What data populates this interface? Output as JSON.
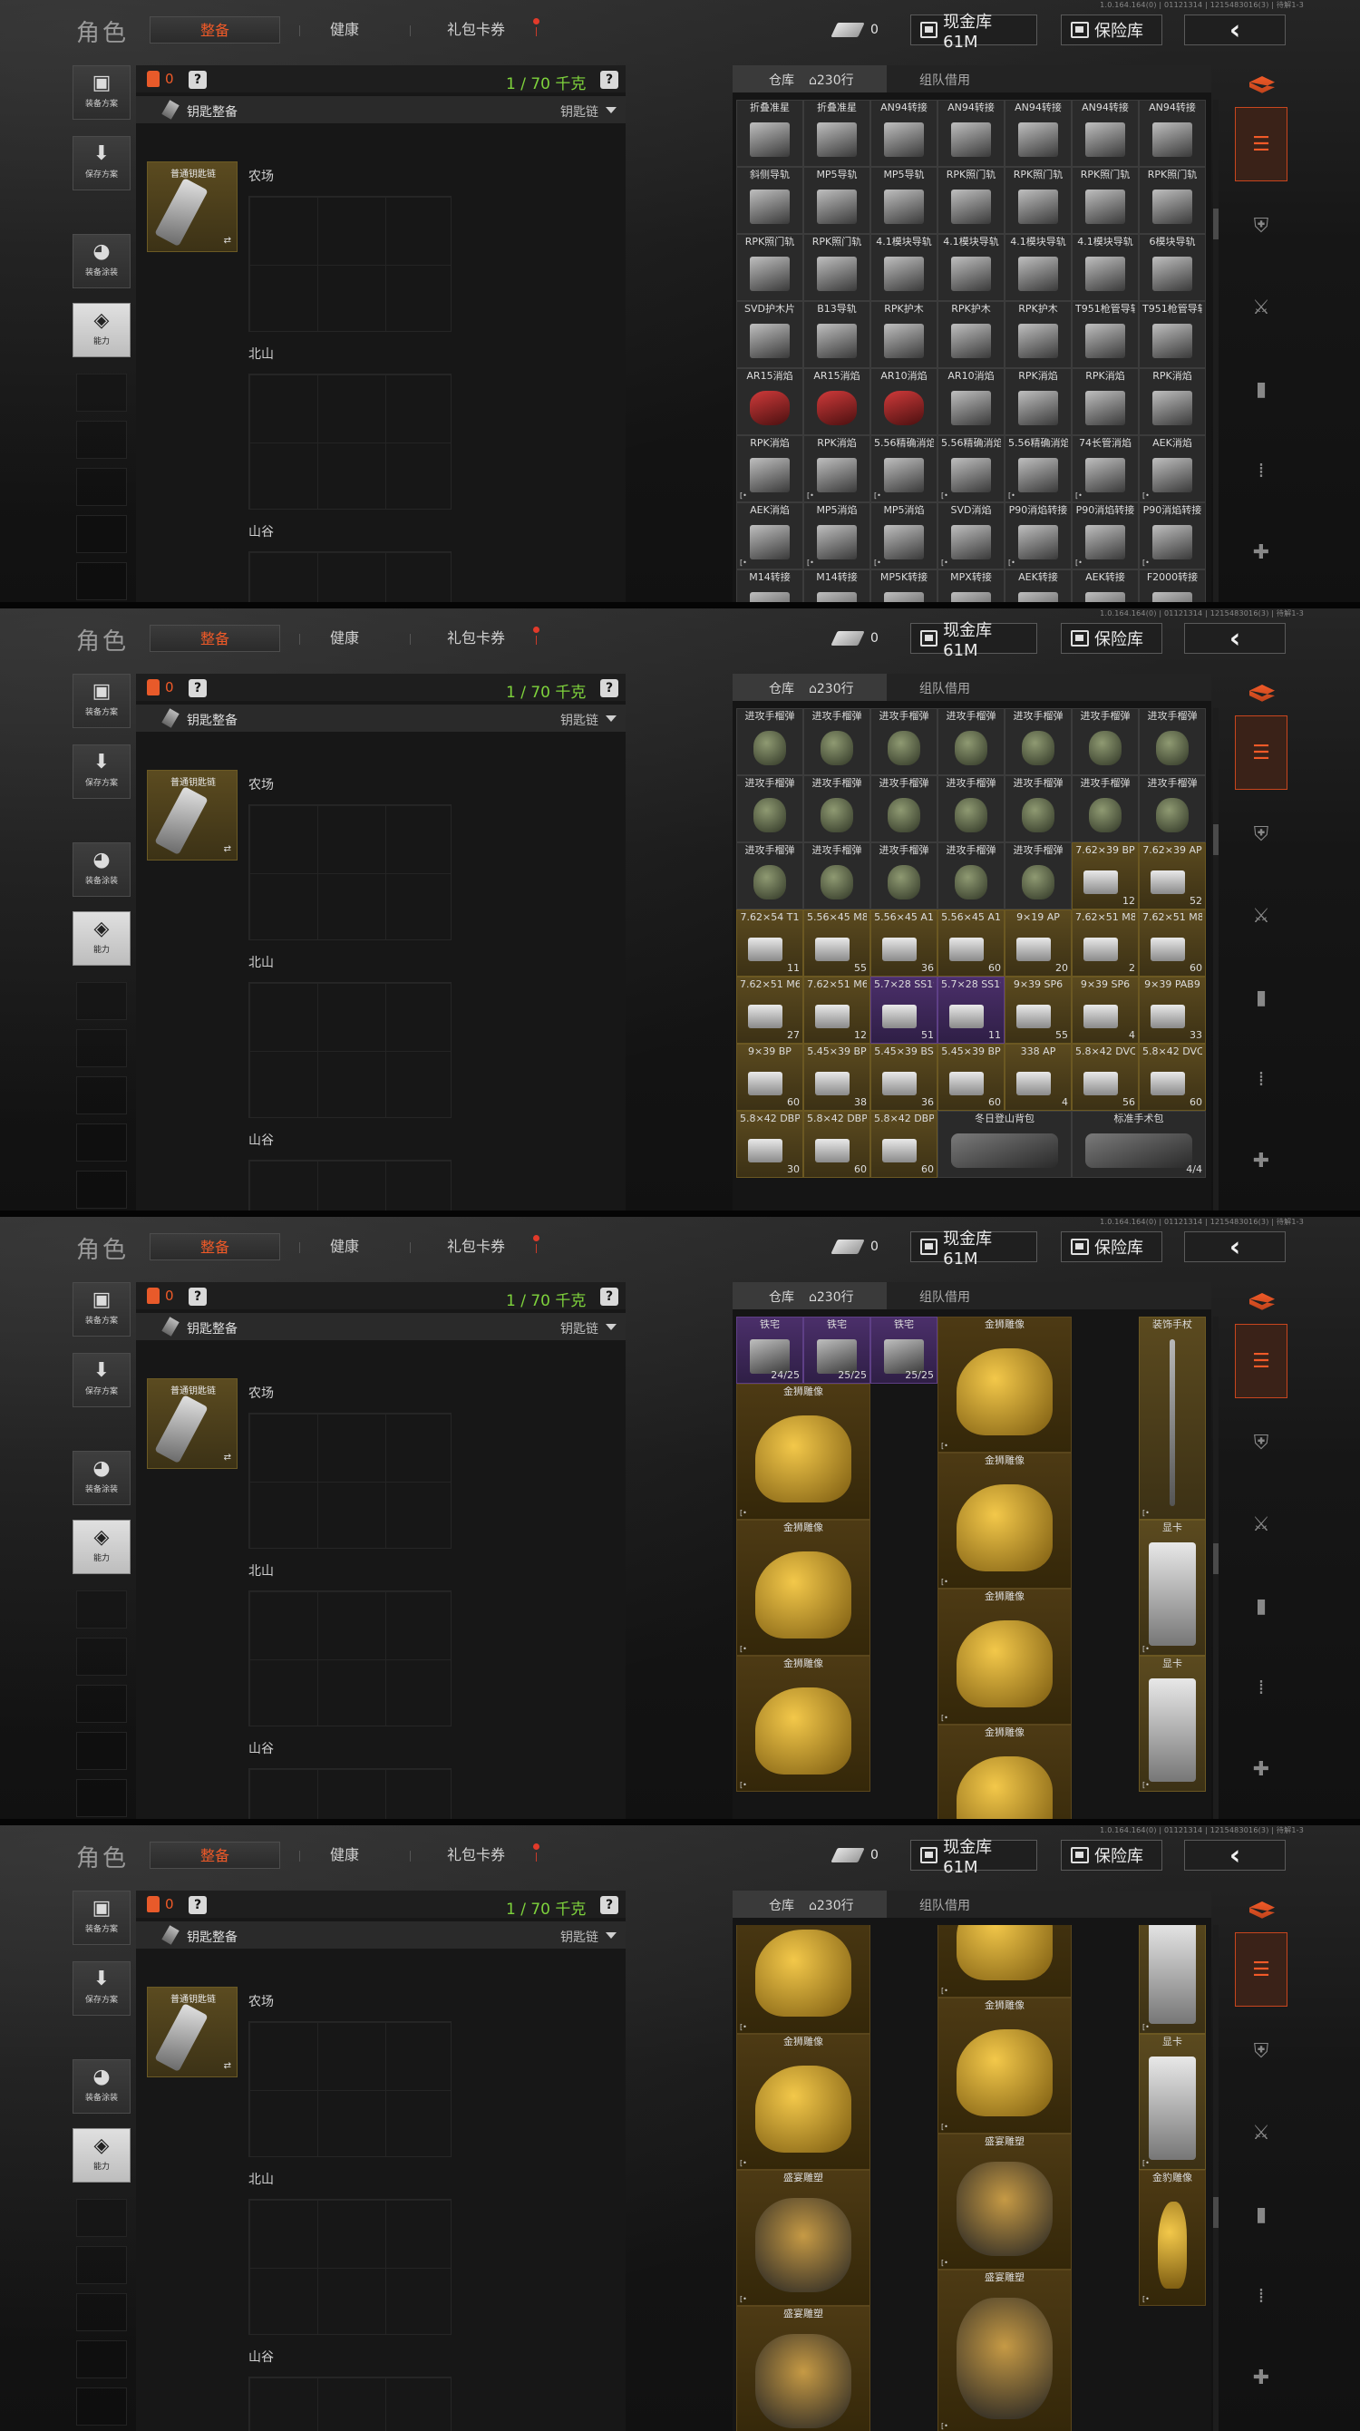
{
  "version": "1.0.164.164(0) | 01121314 | 1215483016(3) | 待解1-3",
  "header": {
    "title": "角色",
    "tabs": [
      "整备",
      "健康",
      "礼包卡券"
    ],
    "key_count": "0",
    "cash_label": "现金库 61M",
    "safe_label": "保险库",
    "back_icon": "‹"
  },
  "left_sidebar": {
    "buttons": [
      "装备方案",
      "保存方案",
      "装备涂装",
      "能力"
    ]
  },
  "equip": {
    "bag_count": "0",
    "weight": "1 / 70 千克",
    "help": "?",
    "key_label": "钥匙整备",
    "chain_label": "钥匙链",
    "key_item_name": "普通钥匙链",
    "regions": [
      "农场",
      "北山",
      "山谷"
    ]
  },
  "warehouse": {
    "tab_label": "仓库",
    "rows_label": "230行",
    "team_label": "组队借用"
  },
  "colors": {
    "accent": "#f05a28",
    "weight_green": "#7ed23c",
    "gold_bg": "#5b4a1f",
    "purple_bg": "#4b2f6a"
  },
  "frames": [
    {
      "items": [
        {
          "n": "折叠准星",
          "c": ""
        },
        {
          "n": "折叠准星",
          "c": ""
        },
        {
          "n": "AN94转接",
          "c": ""
        },
        {
          "n": "AN94转接",
          "c": ""
        },
        {
          "n": "AN94转接",
          "c": ""
        },
        {
          "n": "AN94转接",
          "c": ""
        },
        {
          "n": "AN94转接",
          "c": ""
        },
        {
          "n": "斜侧导轨",
          "c": ""
        },
        {
          "n": "MP5导轨",
          "c": ""
        },
        {
          "n": "MP5导轨",
          "c": ""
        },
        {
          "n": "RPK照门轨",
          "c": ""
        },
        {
          "n": "RPK照门轨",
          "c": ""
        },
        {
          "n": "RPK照门轨",
          "c": ""
        },
        {
          "n": "RPK照门轨",
          "c": ""
        },
        {
          "n": "RPK照门轨",
          "c": ""
        },
        {
          "n": "RPK照门轨",
          "c": ""
        },
        {
          "n": "4.1模块导轨",
          "c": ""
        },
        {
          "n": "4.1模块导轨",
          "c": ""
        },
        {
          "n": "4.1模块导轨",
          "c": ""
        },
        {
          "n": "4.1模块导轨",
          "c": ""
        },
        {
          "n": "6模块导轨",
          "c": ""
        },
        {
          "n": "SVD护木片",
          "c": ""
        },
        {
          "n": "B13导轨",
          "c": ""
        },
        {
          "n": "RPK护木",
          "c": ""
        },
        {
          "n": "RPK护木",
          "c": ""
        },
        {
          "n": "RPK护木",
          "c": ""
        },
        {
          "n": "T951枪管导轨",
          "c": ""
        },
        {
          "n": "T951枪管导轨",
          "c": ""
        },
        {
          "n": "AR15消焰",
          "c": ""
        },
        {
          "n": "AR15消焰",
          "c": ""
        },
        {
          "n": "AR10消焰",
          "c": ""
        },
        {
          "n": "AR10消焰",
          "c": ""
        },
        {
          "n": "RPK消焰",
          "c": ""
        },
        {
          "n": "RPK消焰",
          "c": ""
        },
        {
          "n": "RPK消焰",
          "c": ""
        },
        {
          "n": "RPK消焰",
          "c": ""
        },
        {
          "n": "RPK消焰",
          "c": ""
        },
        {
          "n": "5.56精确消焰",
          "c": ""
        },
        {
          "n": "5.56精确消焰",
          "c": ""
        },
        {
          "n": "5.56精确消焰",
          "c": ""
        },
        {
          "n": "74长管消焰",
          "c": ""
        },
        {
          "n": "AEK消焰",
          "c": ""
        },
        {
          "n": "AEK消焰",
          "c": ""
        },
        {
          "n": "MP5消焰",
          "c": ""
        },
        {
          "n": "MP5消焰",
          "c": ""
        },
        {
          "n": "SVD消焰",
          "c": ""
        },
        {
          "n": "P90消焰转接",
          "c": ""
        },
        {
          "n": "P90消焰转接",
          "c": ""
        },
        {
          "n": "P90消焰转接",
          "c": ""
        },
        {
          "n": "M14转接",
          "c": ""
        },
        {
          "n": "M14转接",
          "c": ""
        },
        {
          "n": "MP5K转接",
          "c": ""
        },
        {
          "n": "MPX转接",
          "c": ""
        },
        {
          "n": "AEK转接",
          "c": ""
        },
        {
          "n": "AEK转接",
          "c": ""
        },
        {
          "n": "F2000转接",
          "c": ""
        }
      ]
    },
    {
      "items": [
        {
          "n": "进攻手榴弹",
          "c": ""
        },
        {
          "n": "进攻手榴弹",
          "c": ""
        },
        {
          "n": "进攻手榴弹",
          "c": ""
        },
        {
          "n": "进攻手榴弹",
          "c": ""
        },
        {
          "n": "进攻手榴弹",
          "c": ""
        },
        {
          "n": "进攻手榴弹",
          "c": ""
        },
        {
          "n": "进攻手榴弹",
          "c": ""
        },
        {
          "n": "进攻手榴弹",
          "c": ""
        },
        {
          "n": "进攻手榴弹",
          "c": ""
        },
        {
          "n": "进攻手榴弹",
          "c": ""
        },
        {
          "n": "进攻手榴弹",
          "c": ""
        },
        {
          "n": "进攻手榴弹",
          "c": ""
        },
        {
          "n": "进攻手榴弹",
          "c": ""
        },
        {
          "n": "进攻手榴弹",
          "c": ""
        },
        {
          "n": "进攻手榴弹",
          "c": ""
        },
        {
          "n": "进攻手榴弹",
          "c": ""
        },
        {
          "n": "进攻手榴弹",
          "c": ""
        },
        {
          "n": "进攻手榴弹",
          "c": ""
        },
        {
          "n": "进攻手榴弹",
          "c": ""
        },
        {
          "n": "7.62×39 BP",
          "c": "12"
        },
        {
          "n": "7.62×39 AP",
          "c": "52"
        },
        {
          "n": "7.62×54 T1",
          "c": "11"
        },
        {
          "n": "5.56×45 M855",
          "c": "55"
        },
        {
          "n": "5.56×45 A1",
          "c": "36"
        },
        {
          "n": "5.56×45 A1",
          "c": "60"
        },
        {
          "n": "9×19 AP",
          "c": "20"
        },
        {
          "n": "7.62×51 M80",
          "c": "2"
        },
        {
          "n": "7.62×51 M80",
          "c": "60"
        },
        {
          "n": "7.62×51 M62",
          "c": "27"
        },
        {
          "n": "7.62×51 M61",
          "c": "12"
        },
        {
          "n": "5.7×28 SS190",
          "c": "51"
        },
        {
          "n": "5.7×28 SS190",
          "c": "11"
        },
        {
          "n": "9×39 SP6",
          "c": "55"
        },
        {
          "n": "9×39 SP6",
          "c": "4"
        },
        {
          "n": "9×39 PAB9",
          "c": "33"
        },
        {
          "n": "9×39 BP",
          "c": "60"
        },
        {
          "n": "5.45×39 BP",
          "c": "38"
        },
        {
          "n": "5.45×39 BS",
          "c": "36"
        },
        {
          "n": "5.45×39 BP",
          "c": "60"
        },
        {
          "n": "338 AP",
          "c": "4"
        },
        {
          "n": "5.8×42 DVC12",
          "c": "56"
        },
        {
          "n": "5.8×42 DVC12",
          "c": "60"
        },
        {
          "n": "5.8×42 DBP88",
          "c": "30"
        },
        {
          "n": "5.8×42 DBP88",
          "c": "60"
        },
        {
          "n": "5.8×42 DBP88",
          "c": "60"
        },
        {
          "n": "冬日登山背包",
          "c": ""
        },
        {
          "n": "标准手术包",
          "c": "4/4"
        }
      ]
    },
    {
      "items": [
        {
          "n": "铁宅",
          "c": "24/25"
        },
        {
          "n": "铁宅",
          "c": "25/25"
        },
        {
          "n": "铁宅",
          "c": "25/25"
        },
        {
          "n": "金狮雕像",
          "c": ""
        },
        {
          "n": "装饰手杖",
          "c": ""
        },
        {
          "n": "金狮雕像",
          "c": ""
        },
        {
          "n": "金狮雕像",
          "c": ""
        },
        {
          "n": "金狮雕像",
          "c": ""
        },
        {
          "n": "金狮雕像",
          "c": ""
        },
        {
          "n": "金狮雕像",
          "c": ""
        },
        {
          "n": "金狮雕像",
          "c": ""
        },
        {
          "n": "显卡",
          "c": ""
        },
        {
          "n": "显卡",
          "c": ""
        }
      ]
    },
    {
      "items": [
        {
          "n": "金狮雕像",
          "c": ""
        },
        {
          "n": "金狮雕像",
          "c": ""
        },
        {
          "n": "显卡",
          "c": ""
        },
        {
          "n": "金狮雕像",
          "c": ""
        },
        {
          "n": "金狮雕像",
          "c": ""
        },
        {
          "n": "显卡",
          "c": ""
        },
        {
          "n": "盛宴雕塑",
          "c": ""
        },
        {
          "n": "盛宴雕塑",
          "c": ""
        },
        {
          "n": "盛宴雕塑",
          "c": ""
        },
        {
          "n": "盛宴雕塑",
          "c": ""
        },
        {
          "n": "金豹雕像",
          "c": ""
        }
      ]
    }
  ]
}
